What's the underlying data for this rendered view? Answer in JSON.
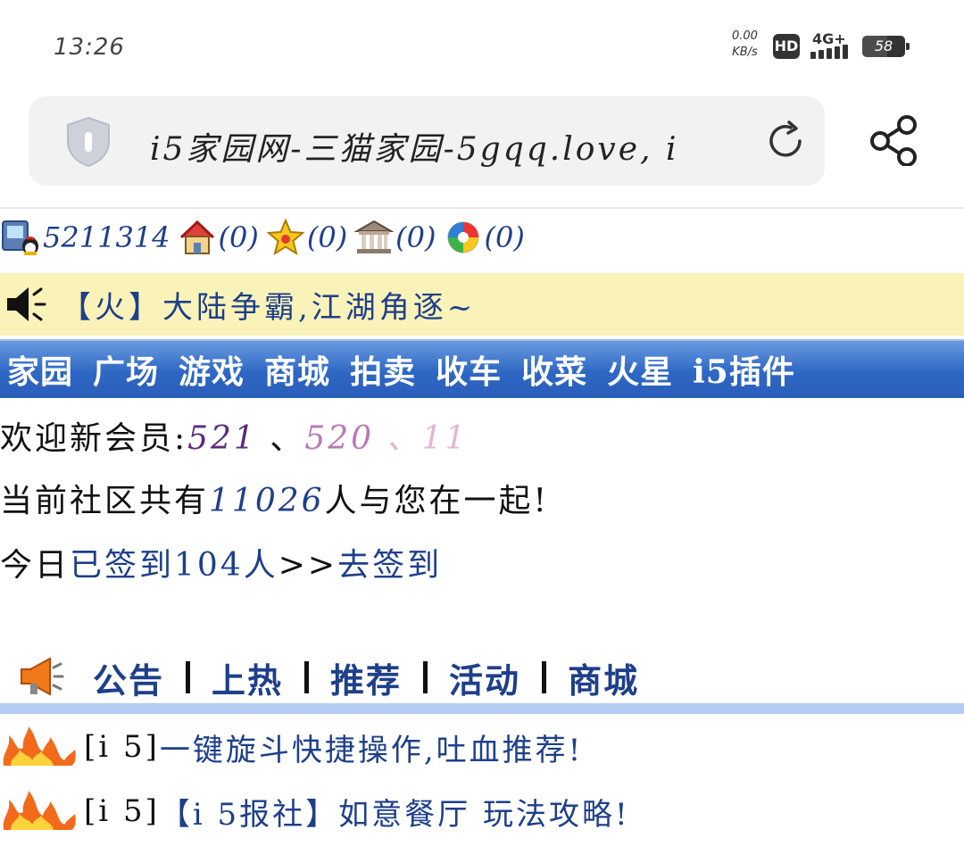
{
  "status_bar": {
    "time": "13:26",
    "net_speed_value": "0.00",
    "net_speed_unit": "KB/s",
    "hd": "HD",
    "network": "4G+",
    "battery": "58"
  },
  "address_bar": {
    "url_text": "i5家园网-三猫家园-5gqq.love, i"
  },
  "user_stats": {
    "qq_number": "5211314",
    "home": "(0)",
    "favorites": "(0)",
    "bank": "(0)",
    "gallery": "(0)"
  },
  "notice": {
    "text": "【火】大陆争霸,江湖角逐~"
  },
  "nav": {
    "items": [
      "家园",
      "广场",
      "游戏",
      "商城",
      "拍卖",
      "收车",
      "收菜",
      "火星",
      "i5插件"
    ]
  },
  "welcome": {
    "label": "欢迎新会员:",
    "members": [
      "521",
      "520",
      "11"
    ],
    "sep": "、"
  },
  "community": {
    "prefix": "当前社区共有",
    "count": "11026",
    "suffix": "人与您在一起!"
  },
  "signin": {
    "prefix": "今日",
    "signed": "已签到104人",
    "arrow": ">>",
    "link": "去签到"
  },
  "tabs": [
    "公告",
    "上热",
    "推荐",
    "活动",
    "商城"
  ],
  "posts": [
    {
      "tag": "[i 5]",
      "title": "一键旋斗快捷操作,吐血推荐!"
    },
    {
      "tag": "[i 5]",
      "title": "【i 5报社】如意餐厅 玩法攻略!"
    }
  ]
}
